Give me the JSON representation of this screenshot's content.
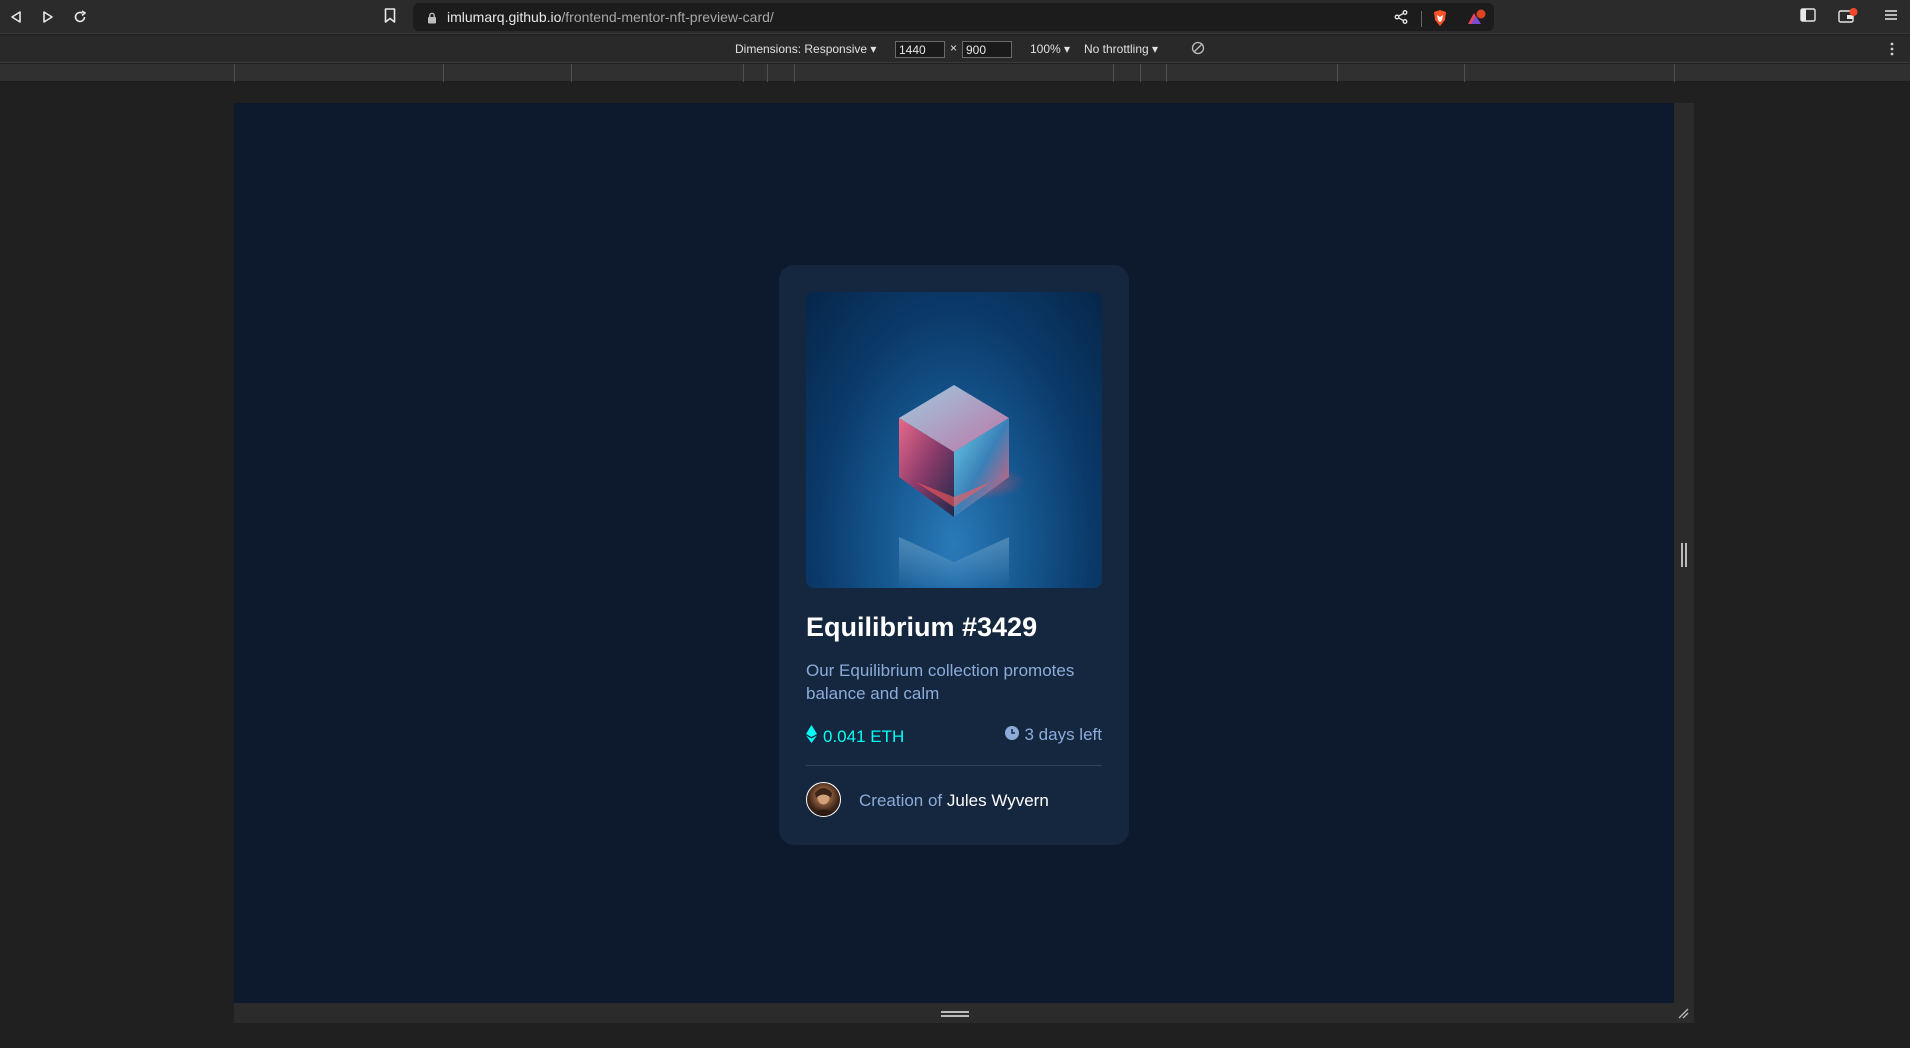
{
  "browser": {
    "url_host": "imlumarq.github.io",
    "url_path": "/frontend-mentor-nft-preview-card/",
    "icons": [
      "back-icon",
      "forward-icon",
      "reload-icon",
      "bookmark-icon",
      "lock-icon",
      "share-icon",
      "brave-shields-icon",
      "brave-rewards-icon",
      "sidebar-icon",
      "wallet-icon",
      "menu-icon"
    ]
  },
  "devtools": {
    "dimensions_label": "Dimensions: Responsive",
    "width": "1440",
    "times": "×",
    "height": "900",
    "zoom": "100%",
    "throttling": "No throttling"
  },
  "card": {
    "title": "Equilibrium #3429",
    "description": "Our Equilibrium collection promotes balance and calm",
    "price": "0.041 ETH",
    "time_left": "3 days left",
    "creator_prefix": "Creation of",
    "creator_name": "Jules Wyvern"
  },
  "colors": {
    "page_bg": "#0d192c",
    "card_bg": "#15263f",
    "cyan": "#00fff7",
    "soft_blue": "#8bacd9",
    "white": "#ffffff"
  }
}
